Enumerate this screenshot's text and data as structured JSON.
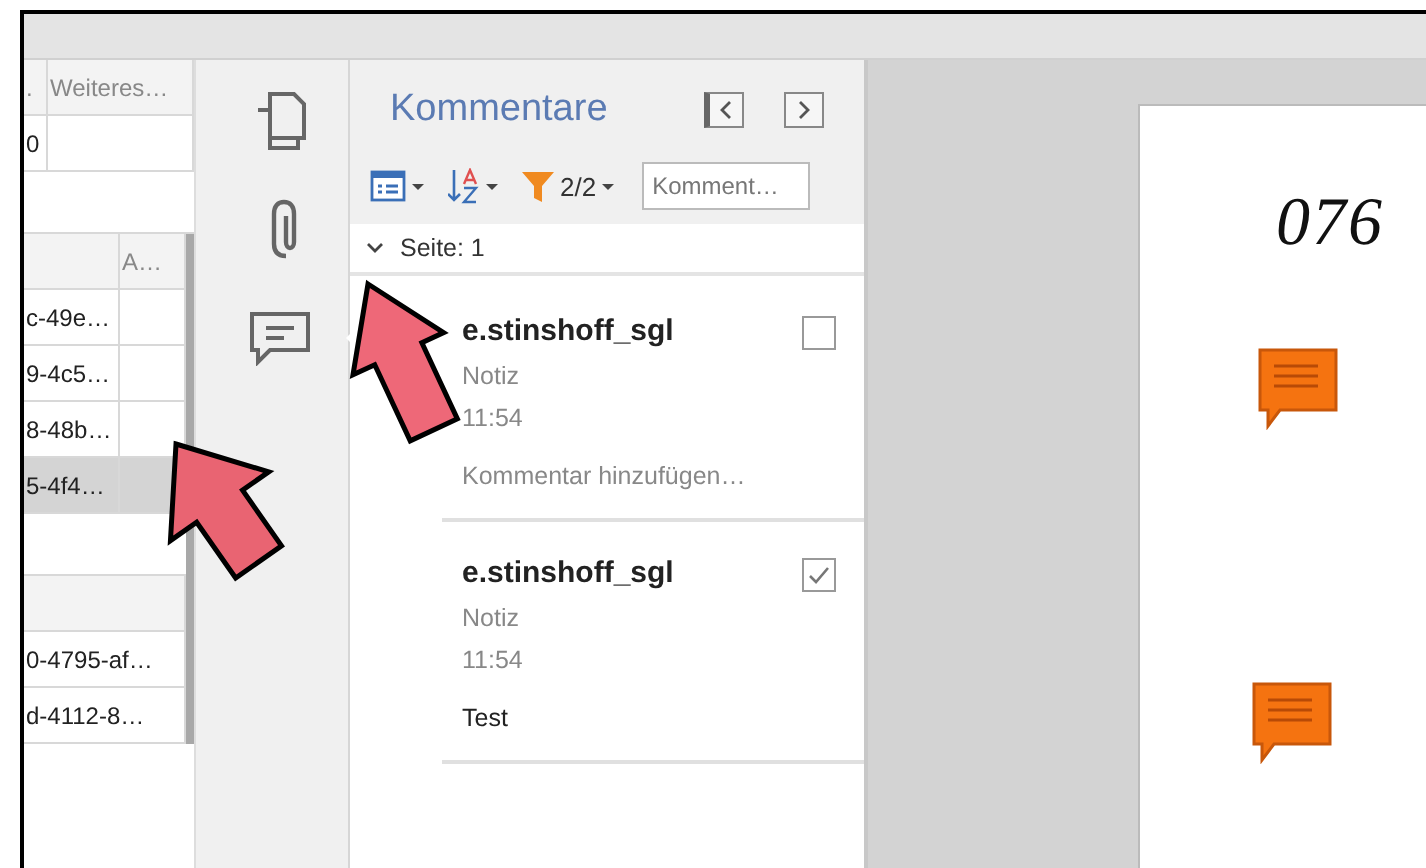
{
  "left_table": {
    "sections": [
      {
        "rows": [
          {
            "kind": "header",
            "cells": [
              {
                "text": "."
              },
              {
                "text": "Weiteres…"
              }
            ]
          },
          {
            "kind": "data",
            "selected": false,
            "cells": [
              {
                "text": "0"
              },
              {}
            ]
          },
          {
            "kind": "blank"
          }
        ]
      },
      {
        "rows": [
          {
            "kind": "header",
            "cells": [
              {},
              {
                "text": "A…"
              }
            ]
          },
          {
            "kind": "data",
            "selected": false,
            "cells": [
              {
                "text": "c-49e…"
              },
              {}
            ]
          },
          {
            "kind": "data",
            "selected": false,
            "cells": [
              {
                "text": "9-4c5…"
              },
              {}
            ]
          },
          {
            "kind": "data",
            "selected": false,
            "cells": [
              {
                "text": "8-48b…"
              },
              {}
            ]
          },
          {
            "kind": "data",
            "selected": true,
            "cells": [
              {
                "text": "5-4f4…"
              },
              {}
            ]
          },
          {
            "kind": "blank"
          }
        ]
      },
      {
        "rows": [
          {
            "kind": "header",
            "cells": [
              {}
            ]
          },
          {
            "kind": "data",
            "selected": false,
            "cells": [
              {
                "text": "0-4795-af…"
              }
            ]
          },
          {
            "kind": "data",
            "selected": false,
            "cells": [
              {
                "text": "d-4112-8…"
              }
            ]
          }
        ]
      }
    ]
  },
  "side_strip": {
    "items": [
      {
        "kind": "pages",
        "selected": false
      },
      {
        "kind": "attachments",
        "selected": false
      },
      {
        "kind": "comments",
        "selected": true
      }
    ]
  },
  "comments_panel": {
    "title": "Kommentare",
    "filter_count": "2/2",
    "search": {
      "placeholder": "Komment…"
    },
    "group": {
      "label": "Seite: 1",
      "expanded": true
    },
    "comments": [
      {
        "author": "e.stinshoff_sgl",
        "type": "Notiz",
        "time": "11:54",
        "placeholder": "Kommentar hinzufügen…",
        "checked": false
      },
      {
        "author": "e.stinshoff_sgl",
        "type": "Notiz",
        "time": "11:54",
        "text": "Test",
        "checked": true
      }
    ]
  },
  "document": {
    "handwriting": "076"
  }
}
